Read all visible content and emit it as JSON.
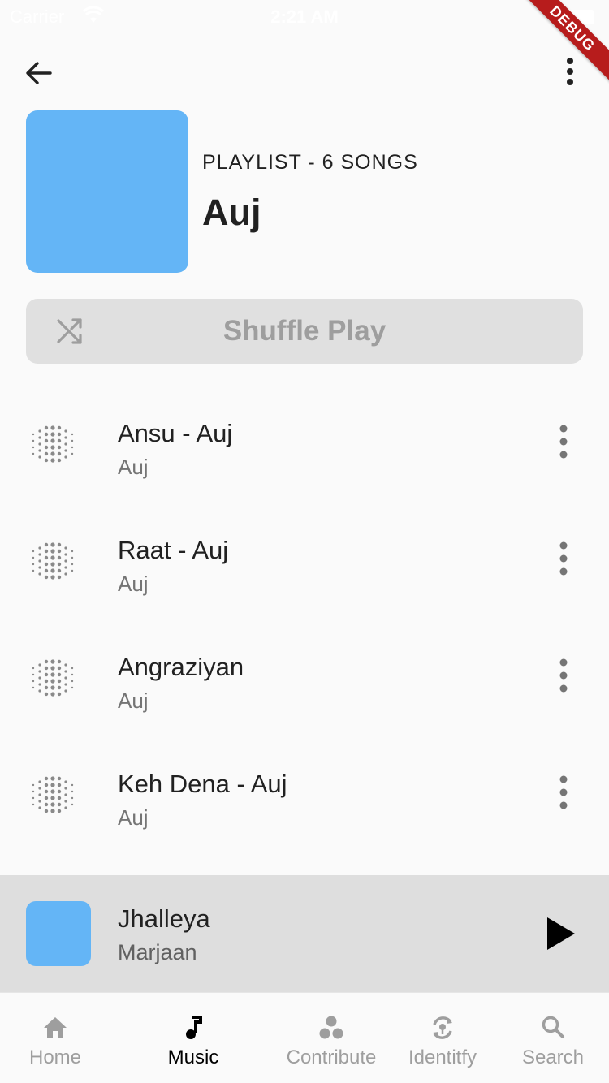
{
  "status_bar": {
    "carrier": "Carrier",
    "time": "2:21 AM"
  },
  "debug_banner": "DEBUG",
  "playlist": {
    "subtitle": "PLAYLIST - 6 SONGS",
    "title": "Auj",
    "cover_color": "#64b5f6"
  },
  "shuffle": {
    "label": "Shuffle Play"
  },
  "songs": [
    {
      "title": "Ansu - Auj",
      "artist": "Auj"
    },
    {
      "title": "Raat - Auj",
      "artist": "Auj"
    },
    {
      "title": "Angraziyan",
      "artist": "Auj"
    },
    {
      "title": "Keh Dena - Auj",
      "artist": "Auj"
    }
  ],
  "now_playing": {
    "title": "Jhalleya",
    "artist": "Marjaan",
    "cover_color": "#64b5f6"
  },
  "bottom_nav": {
    "active": "Music",
    "active_color": "#000000",
    "inactive_color": "#9e9e9e",
    "items": [
      {
        "label": "Home",
        "icon": "home-icon"
      },
      {
        "label": "Music",
        "icon": "music-note-icon"
      },
      {
        "label": "Contribute",
        "icon": "group-dots-icon"
      },
      {
        "label": "Identitfy",
        "icon": "identify-icon"
      },
      {
        "label": "Search",
        "icon": "search-icon"
      }
    ]
  }
}
